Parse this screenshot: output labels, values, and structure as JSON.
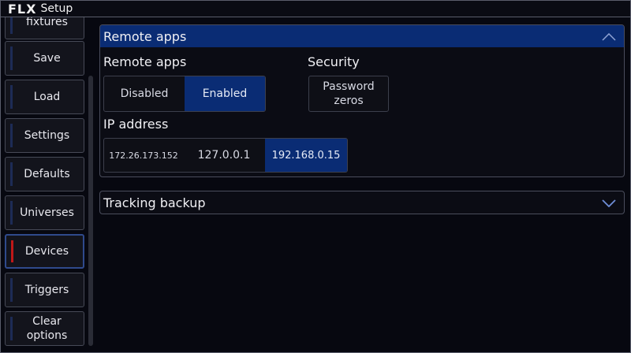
{
  "window": {
    "logo": "FLX",
    "title": "Setup"
  },
  "sidebar": {
    "items": [
      {
        "label": "fixtures"
      },
      {
        "label": "Save"
      },
      {
        "label": "Load"
      },
      {
        "label": "Settings"
      },
      {
        "label": "Defaults"
      },
      {
        "label": "Universes"
      },
      {
        "label": "Devices",
        "active": true
      },
      {
        "label": "Triggers"
      },
      {
        "label": "Clear\noptions"
      }
    ]
  },
  "remote_panel": {
    "header": "Remote apps",
    "remote_apps_label": "Remote apps",
    "options": [
      "Disabled",
      "Enabled"
    ],
    "selected": "Enabled",
    "security_label": "Security",
    "password_button": "Password\nzeros",
    "ip_label": "IP address",
    "ip_options": [
      "172.26.173.152",
      "127.0.0.1",
      "192.168.0.15"
    ],
    "ip_selected": "192.168.0.15"
  },
  "tracking_panel": {
    "header": "Tracking backup"
  },
  "colors": {
    "accent": "#0a2c74",
    "active_marker": "#c01818",
    "border": "#4a4d5c"
  }
}
